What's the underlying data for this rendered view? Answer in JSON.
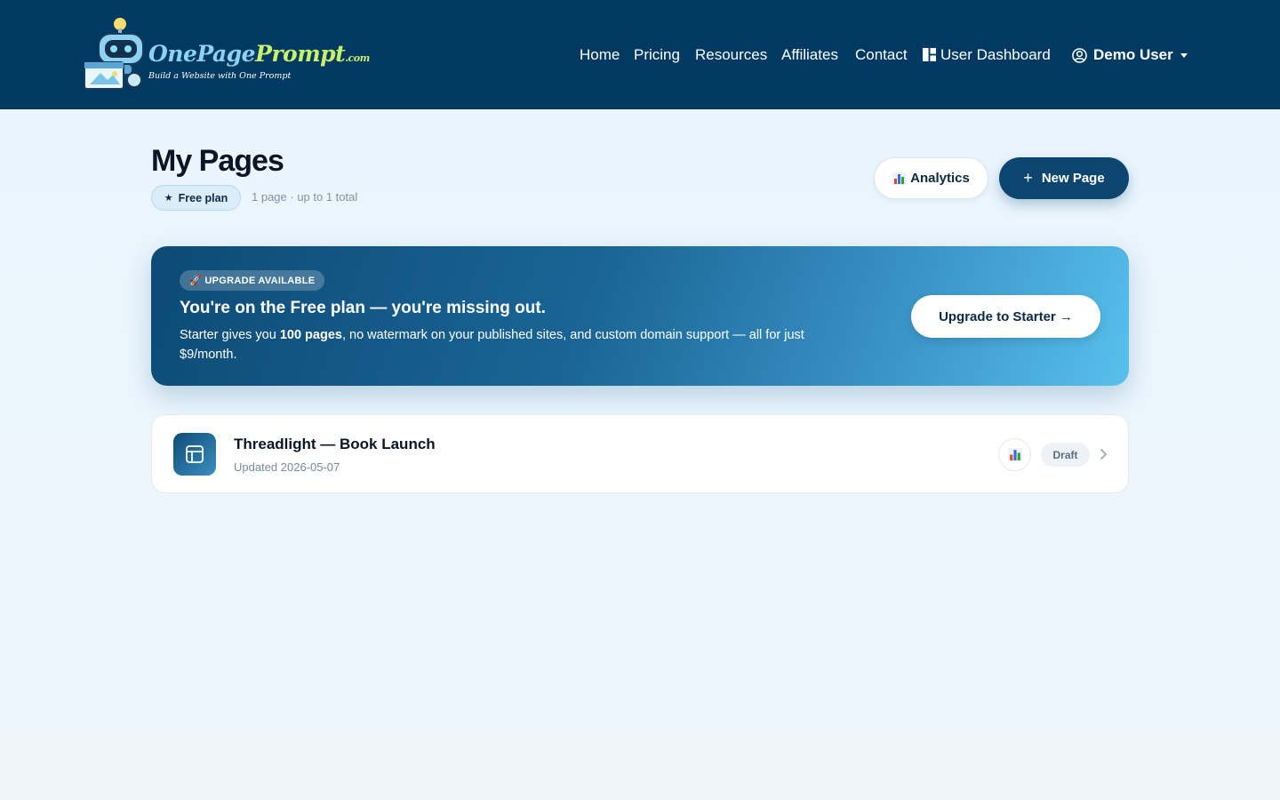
{
  "header": {
    "logo": {
      "name_part1": "OnePage",
      "name_part2": "Prompt",
      "name_suffix": ".com",
      "tagline": "Build a Website with One Prompt"
    },
    "nav": [
      {
        "label": "Home"
      },
      {
        "label": "Pricing"
      },
      {
        "label": "Resources"
      },
      {
        "label": "Affiliates"
      },
      {
        "label": "Contact"
      },
      {
        "label": "User Dashboard"
      }
    ],
    "user": {
      "name": "Demo User"
    }
  },
  "page": {
    "title": "My Pages",
    "plan_badge": "Free plan",
    "plan_meta": "1 page · up to 1 total",
    "analytics_label": "Analytics",
    "new_page_label": "New Page"
  },
  "banner": {
    "badge": "🚀 UPGRADE AVAILABLE",
    "title": "You're on the Free plan — you're missing out.",
    "text_before": "Starter gives you ",
    "text_bold": "100 pages",
    "text_after": ", no watermark on your published sites, and custom domain support — all for just $9/month.",
    "cta": "Upgrade to Starter →"
  },
  "pages": [
    {
      "name": "Threadlight — Book Launch",
      "updated": "Updated 2026-05-07",
      "status": "Draft"
    }
  ],
  "colors": {
    "header_bg": "#003a63",
    "primary": "#0c4670",
    "accent": "#58c0ec"
  }
}
